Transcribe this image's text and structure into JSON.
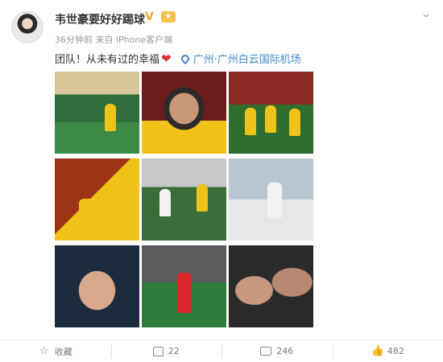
{
  "user": {
    "name": "韦世豪要好好踢球",
    "verified_mark": "V"
  },
  "meta": {
    "time": "36分钟前",
    "source": "来自 iPhone客户端"
  },
  "post": {
    "text": "团队！从未有过的幸福",
    "location": "广州·广州白云国际机场"
  },
  "images": [
    {
      "index": 1
    },
    {
      "index": 2
    },
    {
      "index": 3
    },
    {
      "index": 4
    },
    {
      "index": 5
    },
    {
      "index": 6
    },
    {
      "index": 7
    },
    {
      "index": 8
    },
    {
      "index": 9
    }
  ],
  "actions": {
    "favorite_label": "收藏",
    "repost_count": "22",
    "comment_count": "246",
    "like_count": "482"
  },
  "icons": {
    "verified": "verified-badge-icon",
    "fans": "fans-badge-icon",
    "more": "chevron-down-icon",
    "location": "location-pin-icon",
    "favorite": "star-icon",
    "repost": "repost-icon",
    "comment": "comment-icon",
    "like": "thumbs-up-icon"
  },
  "colors": {
    "link": "#3e89c8",
    "verified": "#f5a623",
    "heart": "#e0303a"
  }
}
